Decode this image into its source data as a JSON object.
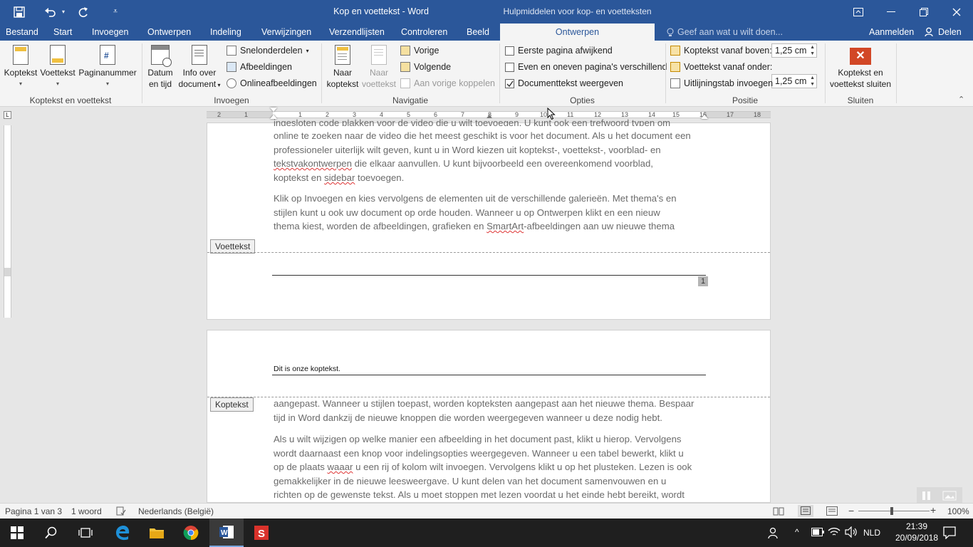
{
  "title_bar": {
    "title": "Kop en voettekst - Word",
    "contextual_group": "Hulpmiddelen voor kop- en voetteksten"
  },
  "tabs": {
    "file": "Bestand",
    "items": [
      "Start",
      "Invoegen",
      "Ontwerpen",
      "Indeling",
      "Verwijzingen",
      "Verzendlijsten",
      "Controleren",
      "Beeld"
    ],
    "active": "Ontwerpen",
    "tell_me": "Geef aan wat u wilt doen...",
    "sign_in": "Aanmelden",
    "share": "Delen"
  },
  "ribbon": {
    "header_footer": {
      "header": "Koptekst",
      "footer": "Voettekst",
      "page_number": "Paginanummer",
      "label": "Koptekst en voettekst"
    },
    "insert": {
      "date_time_1": "Datum",
      "date_time_2": "en tijd",
      "doc_info_1": "Info over",
      "doc_info_2": "document",
      "quick_parts": "Snelonderdelen",
      "pictures": "Afbeeldingen",
      "online_pictures": "Onlineafbeeldingen",
      "label": "Invoegen"
    },
    "navigation": {
      "goto_header_1": "Naar",
      "goto_header_2": "koptekst",
      "goto_footer_1": "Naar",
      "goto_footer_2": "voettekst",
      "previous": "Vorige",
      "next": "Volgende",
      "link_previous": "Aan vorige koppelen",
      "label": "Navigatie"
    },
    "options": {
      "different_first": "Eerste pagina afwijkend",
      "different_odd_even": "Even en oneven pagina's verschillend",
      "show_document_text": "Documenttekst weergeven",
      "show_document_text_checked": true,
      "label": "Opties"
    },
    "position": {
      "header_from_top": "Koptekst vanaf boven:",
      "header_from_top_value": "1,25 cm",
      "footer_from_bottom": "Voettekst vanaf onder:",
      "footer_from_bottom_value": "1,25 cm",
      "insert_alignment_tab": "Uitlijningstab invoegen",
      "label": "Positie"
    },
    "close": {
      "close_1": "Koptekst en",
      "close_2": "voettekst sluiten",
      "label": "Sluiten"
    }
  },
  "ruler": {
    "left_ticks": [
      "2",
      "1"
    ],
    "ticks": [
      "1",
      "2",
      "3",
      "4",
      "5",
      "6",
      "7",
      "8",
      "9",
      "10",
      "11",
      "12",
      "13",
      "14",
      "15",
      "16",
      "17",
      "18"
    ]
  },
  "document": {
    "page1": {
      "cut_line": "ingesloten code plakken voor de video die u wilt toevoegen. U kunt ook een trefwoord typen om",
      "p1_l1": "online te zoeken naar de video die het meest geschikt is voor het document. Als u het document een",
      "p1_l2": "professioneler uiterlijk wilt geven, kunt u in Word kiezen uit koptekst-, voettekst-, voorblad- en",
      "p1_l3a": "tekstvakontwerpen",
      "p1_l3b": " die elkaar aanvullen. U kunt bijvoorbeeld een overeenkomend voorblad,",
      "p1_l4a": "koptekst en ",
      "p1_l4b": "sidebar",
      "p1_l4c": " toevoegen.",
      "p2_l1": "Klik op Invoegen en kies vervolgens de elementen uit de verschillende galerieën. Met thema's en",
      "p2_l2": "stijlen kunt u ook uw document op orde houden. Wanneer u op Ontwerpen klikt en een nieuw",
      "p2_l3a": "thema kiest, worden de afbeeldingen, grafieken en ",
      "p2_l3b": "SmartArt",
      "p2_l3c": "-afbeeldingen aan uw nieuwe thema",
      "footer_label": "Voettekst",
      "page_number": "1"
    },
    "page2": {
      "header_text": "Dit is onze koptekst.",
      "header_label": "Koptekst",
      "p1_l1": "aangepast. Wanneer u stijlen toepast, worden kopteksten aangepast aan het nieuwe thema. Bespaar",
      "p1_l2": "tijd in Word dankzij de nieuwe knoppen die worden weergegeven wanneer u deze nodig hebt.",
      "p2_l1": "Als u wilt wijzigen op welke manier een afbeelding in het document past, klikt u hierop. Vervolgens",
      "p2_l2": "wordt daarnaast een knop voor indelingsopties weergegeven. Wanneer u een tabel bewerkt, klikt u",
      "p2_l3a": "op de plaats ",
      "p2_l3b": "waaar",
      "p2_l3c": " u een rij of kolom wilt invoegen. Vervolgens klikt u op het plusteken. Lezen is ook",
      "p2_l4": "gemakkelijker in de nieuwe leesweergave. U kunt delen van het document samenvouwen en u",
      "p2_l5": "richten op de gewenste tekst. Als u moet stoppen met lezen voordat u het einde hebt bereikt, wordt"
    }
  },
  "status_bar": {
    "page": "Pagina 1 van 3",
    "words": "1 woord",
    "language": "Nederlands (België)",
    "zoom": "100%"
  },
  "taskbar": {
    "language": "NLD",
    "time": "21:39",
    "date": "20/09/2018"
  },
  "colors": {
    "word_blue": "#2b579a",
    "close_red": "#d24726"
  }
}
